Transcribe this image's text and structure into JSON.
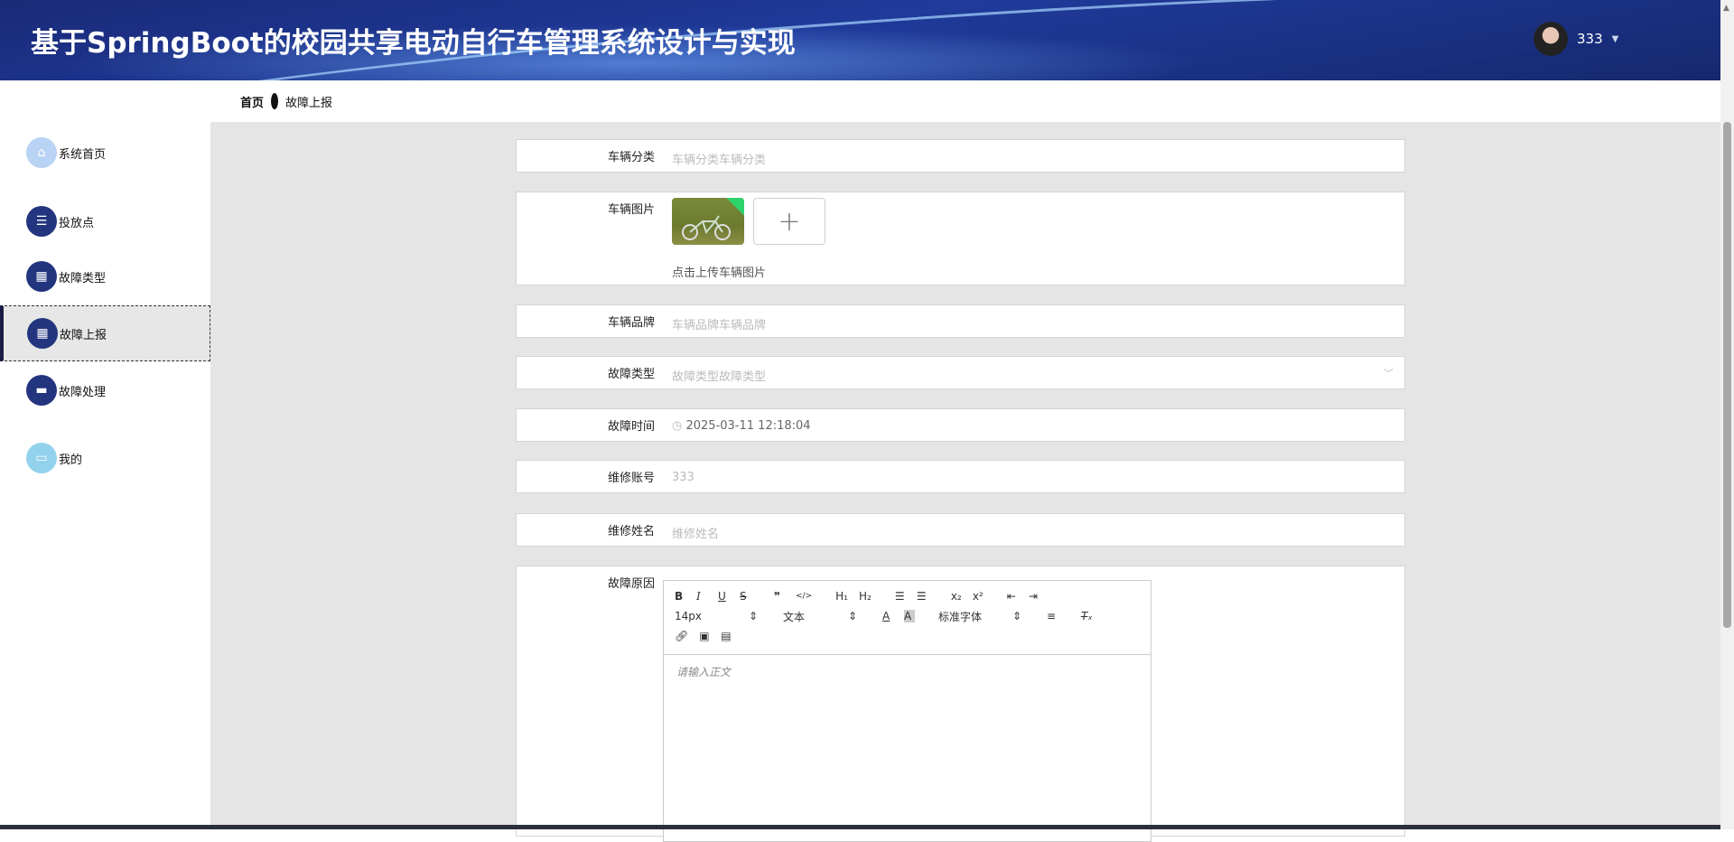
{
  "header": {
    "title": "基于SpringBoot的校园共享电动自行车管理系统设计与实现",
    "username": "333"
  },
  "breadcrumb": {
    "home": "首页",
    "current": "故障上报"
  },
  "sidebar": {
    "items": [
      {
        "label": "系统首页",
        "icon": "home-icon"
      },
      {
        "label": "投放点",
        "icon": "list-icon"
      },
      {
        "label": "故障类型",
        "icon": "grid-icon"
      },
      {
        "label": "故障上报",
        "icon": "grid-icon",
        "active": true
      },
      {
        "label": "故障处理",
        "icon": "monitor-icon"
      },
      {
        "label": "我的",
        "icon": "card-icon"
      }
    ]
  },
  "form": {
    "category": {
      "label": "车辆分类",
      "placeholder": "车辆分类车辆分类"
    },
    "image": {
      "label": "车辆图片",
      "hint": "点击上传车辆图片"
    },
    "brand": {
      "label": "车辆品牌",
      "placeholder": "车辆品牌车辆品牌"
    },
    "fault_type": {
      "label": "故障类型",
      "placeholder": "故障类型故障类型"
    },
    "fault_time": {
      "label": "故障时间",
      "value": "2025-03-11 12:18:04"
    },
    "account": {
      "label": "维修账号",
      "value": "333"
    },
    "name": {
      "label": "维修姓名",
      "placeholder": "维修姓名"
    },
    "reason": {
      "label": "故障原因",
      "placeholder": "请输入正文",
      "font_size": "14px",
      "text_style": "文本",
      "font_family": "标准字体"
    }
  }
}
